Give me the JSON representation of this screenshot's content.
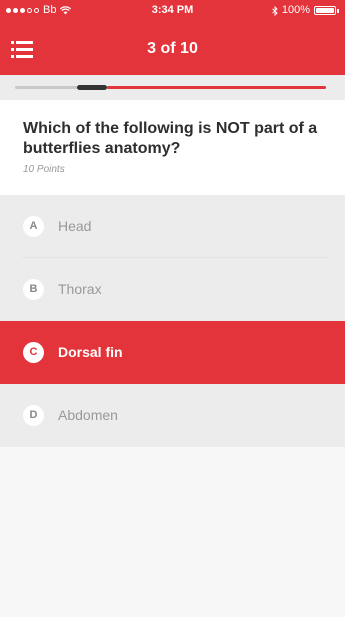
{
  "status_bar": {
    "carrier": "Bb",
    "time": "3:34 PM",
    "battery": "100%"
  },
  "nav": {
    "title": "3 of 10",
    "menu_icon": "list-icon"
  },
  "progress": {
    "current": 3,
    "total": 10
  },
  "question": {
    "text": "Which of the following is NOT part of a butterflies anatomy?",
    "points": "10 Points"
  },
  "answers": [
    {
      "letter": "A",
      "label": "Head",
      "selected": false
    },
    {
      "letter": "B",
      "label": "Thorax",
      "selected": false
    },
    {
      "letter": "C",
      "label": "Dorsal fin",
      "selected": true
    },
    {
      "letter": "D",
      "label": "Abdomen",
      "selected": false
    }
  ],
  "colors": {
    "accent": "#e2343a",
    "background": "#ececec"
  }
}
